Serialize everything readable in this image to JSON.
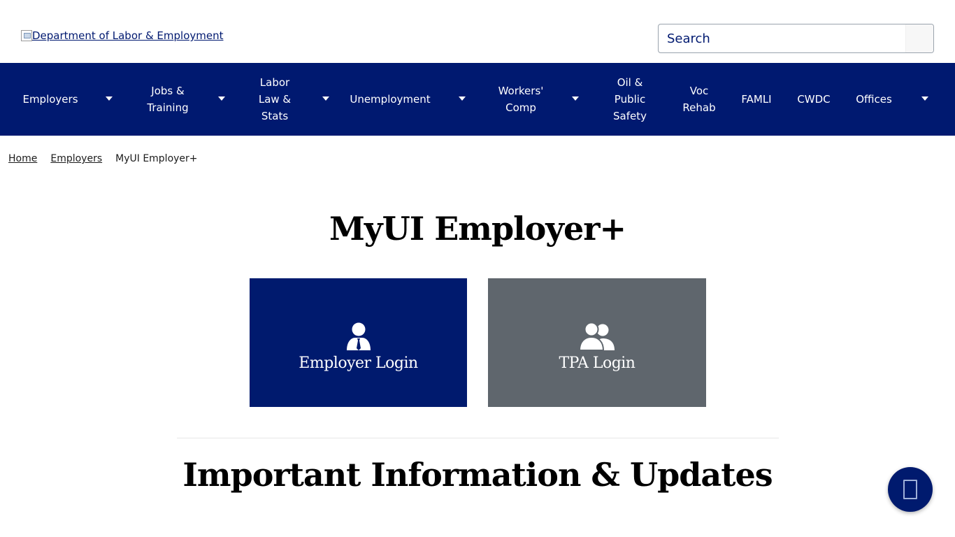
{
  "header": {
    "logo_alt": "Department of Labor & Employment",
    "search_placeholder": "Search"
  },
  "nav": {
    "items": [
      {
        "label": "Employers",
        "dropdown": true
      },
      {
        "label": "Jobs & Training",
        "dropdown": true
      },
      {
        "label": "Labor Law & Stats",
        "dropdown": true
      },
      {
        "label": "Unemployment",
        "dropdown": true
      },
      {
        "label": "Workers' Comp",
        "dropdown": true
      },
      {
        "label": "Oil & Public Safety",
        "dropdown": false
      },
      {
        "label": "Voc Rehab",
        "dropdown": false
      },
      {
        "label": "FAMLI",
        "dropdown": false
      },
      {
        "label": "CWDC",
        "dropdown": false
      },
      {
        "label": "Offices",
        "dropdown": true
      }
    ]
  },
  "breadcrumb": {
    "home": "Home",
    "employers": "Employers",
    "current": "MyUI Employer+"
  },
  "main": {
    "title": "MyUI Employer+",
    "employer_login": "Employer Login",
    "tpa_login": "TPA Login",
    "section_title": "Important Information & Updates"
  },
  "colors": {
    "brand_navy": "#001970",
    "tpa_gray": "#5f666d"
  }
}
